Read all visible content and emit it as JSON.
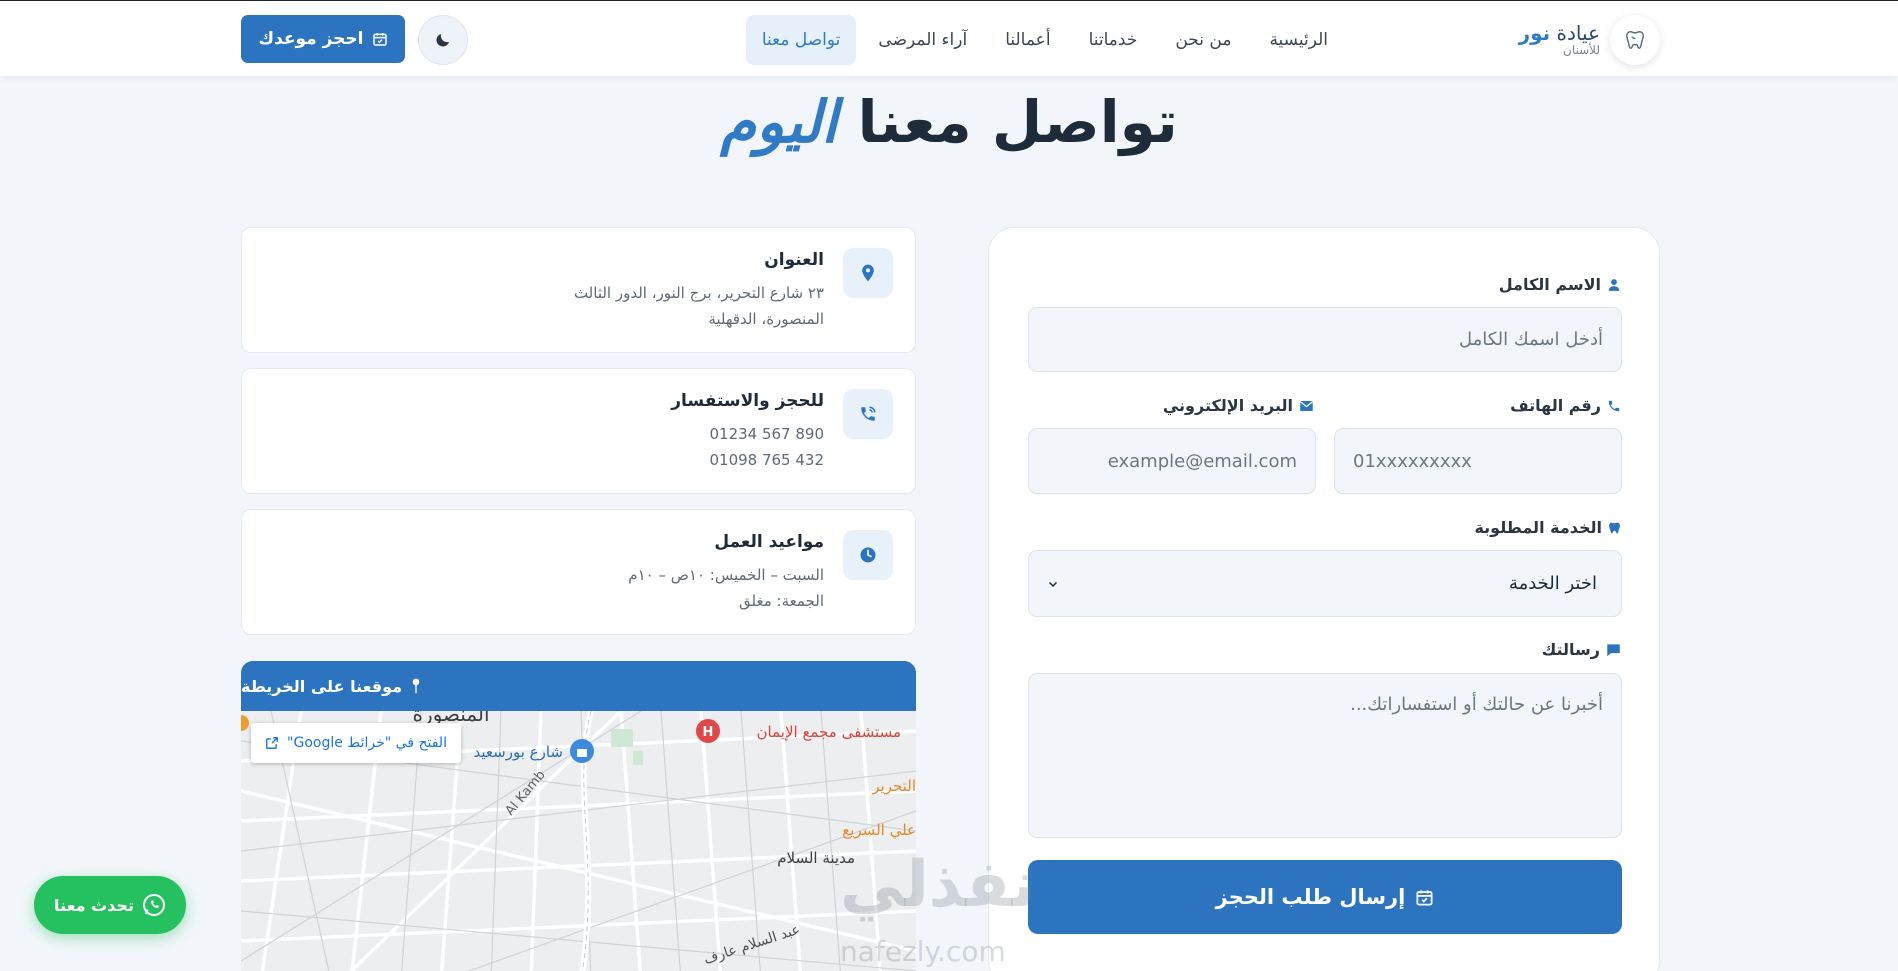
{
  "header": {
    "brand_name_prefix": "عيادة ",
    "brand_name_accent": "نور",
    "brand_sub": "للأسنان",
    "logo_icon": "tooth-icon",
    "nav": [
      {
        "label": "الرئيسية",
        "active": false
      },
      {
        "label": "من نحن",
        "active": false
      },
      {
        "label": "خدماتنا",
        "active": false
      },
      {
        "label": "أعمالنا",
        "active": false
      },
      {
        "label": "آراء المرضى",
        "active": false
      },
      {
        "label": "تواصل معنا",
        "active": true
      }
    ],
    "theme_icon": "moon-icon",
    "book_label": "احجز موعدك"
  },
  "title": {
    "main": "تواصل معنا ",
    "accent": "اليوم"
  },
  "form": {
    "name_label": "الاسم الكامل",
    "name_placeholder": "أدخل اسمك الكامل",
    "phone_label": "رقم الهاتف",
    "phone_placeholder": "01xxxxxxxxx",
    "email_label": "البريد الإلكتروني",
    "email_placeholder": "example@email.com",
    "service_label": "الخدمة المطلوبة",
    "service_selected": "اختر الخدمة",
    "message_label": "رسالتك",
    "message_placeholder": "أخبرنا عن حالتك أو استفساراتك...",
    "submit_label": "إرسال طلب الحجز"
  },
  "info": {
    "address": {
      "title": "العنوان",
      "line1": "٢٣ شارع التحرير، برج النور، الدور الثالث",
      "line2": "المنصورة، الدقهلية"
    },
    "contact": {
      "title": "للحجز والاستفسار",
      "line1": "01234 567 890",
      "line2": "01098 765 432"
    },
    "hours": {
      "title": "مواعيد العمل",
      "line1": "السبت – الخميس: ١٠ص – ١٠م",
      "line2": "الجمعة: مغلق"
    }
  },
  "map": {
    "header": "موقعنا على الخريطة",
    "open_label": "الفتح في \"خرائط Google\"",
    "labels": {
      "city": "المنصورة",
      "hospital": "مستشفى مجمع الإيمان",
      "street1": "شارع بورسعيد",
      "street2": "التحرير",
      "street3": "علي السريع",
      "district": "مدينة السلام",
      "kamb": "Al Kamb",
      "abd_salam": "عبد السلام عارف"
    }
  },
  "whatsapp_label": "تحدث معنا",
  "watermark": {
    "main": "نفذلي",
    "sub": "nafezly.com"
  },
  "colors": {
    "primary": "#2c74bf",
    "accent": "#2f7bc6",
    "whatsapp": "#25c160",
    "background": "#f2f6fa"
  }
}
